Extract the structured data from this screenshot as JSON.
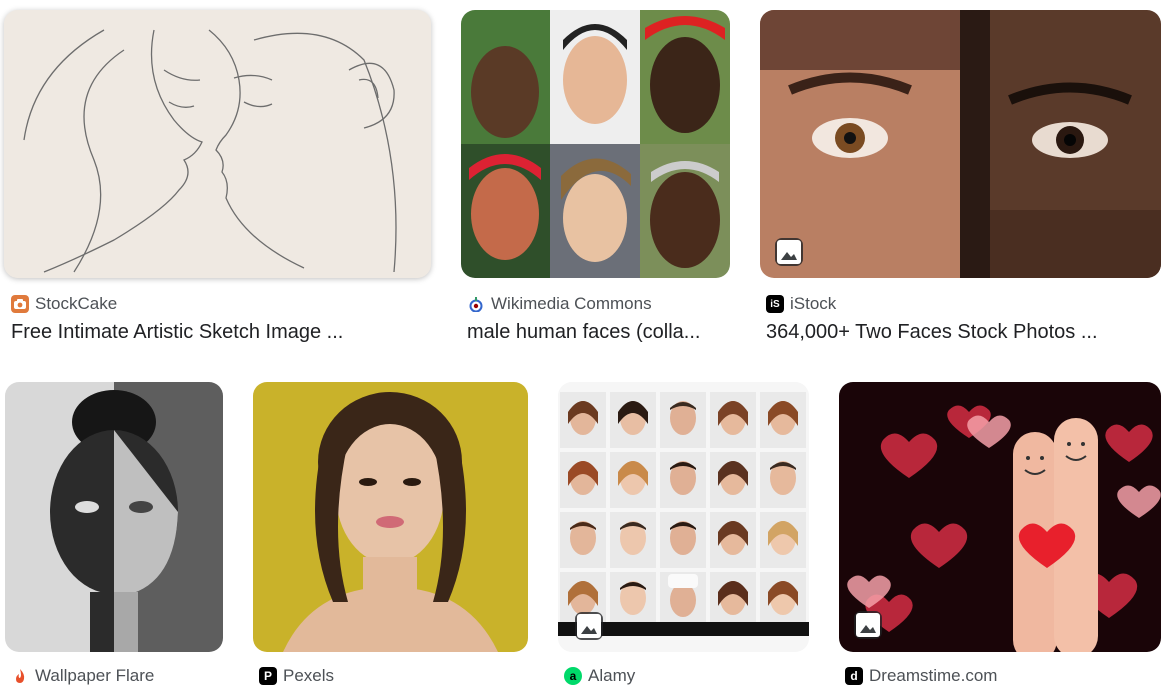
{
  "results": [
    {
      "source": "StockCake",
      "title": "Free Intimate Artistic Sketch Image ...",
      "favicon": "stockcake-icon",
      "favicon_color": "#e07a3c"
    },
    {
      "source": "Wikimedia Commons",
      "title": "male human faces (colla...",
      "favicon": "wikimedia-icon",
      "favicon_color": "#3366cc"
    },
    {
      "source": "iStock",
      "title": "364,000+ Two Faces Stock Photos ...",
      "favicon": "istock-icon",
      "favicon_color": "#000000"
    },
    {
      "source": "Wallpaper Flare",
      "title": "",
      "favicon": "wallpaper-flare-icon",
      "favicon_color": "#e8502b"
    },
    {
      "source": "Pexels",
      "title": "",
      "favicon": "pexels-icon",
      "favicon_color": "#000000"
    },
    {
      "source": "Alamy",
      "title": "",
      "favicon": "alamy-icon",
      "favicon_color": "#00d96a"
    },
    {
      "source": "Dreamstime.com",
      "title": "",
      "favicon": "dreamstime-icon",
      "favicon_color": "#000000"
    }
  ],
  "favicon_glyphs": {
    "istock": "iS",
    "pexels": "P",
    "alamy": "a",
    "dreamstime": "d"
  }
}
